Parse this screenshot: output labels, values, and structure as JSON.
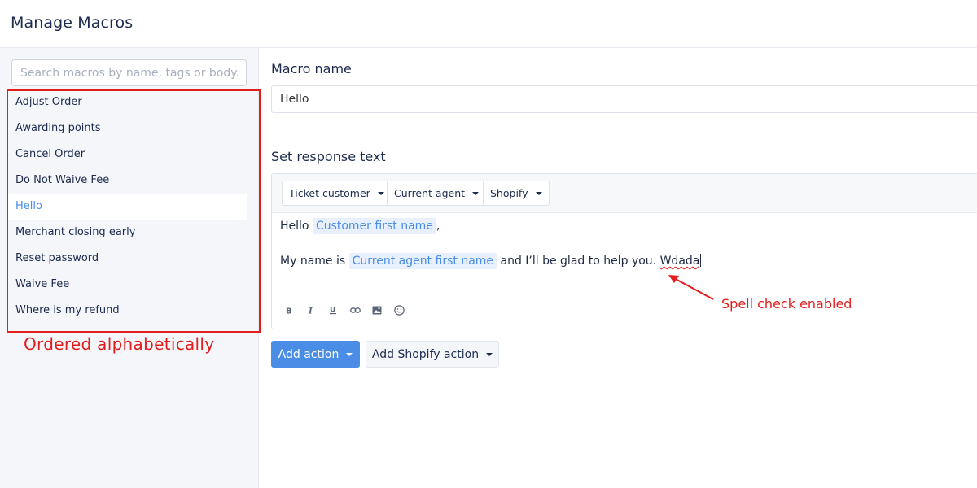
{
  "header": {
    "title": "Manage Macros"
  },
  "sidebar": {
    "search_placeholder": "Search macros by name, tags or body...",
    "macros": [
      {
        "label": "Adjust Order",
        "active": false
      },
      {
        "label": "Awarding points",
        "active": false
      },
      {
        "label": "Cancel Order",
        "active": false
      },
      {
        "label": "Do Not Waive Fee",
        "active": false
      },
      {
        "label": "Hello",
        "active": true
      },
      {
        "label": "Merchant closing early",
        "active": false
      },
      {
        "label": "Reset password",
        "active": false
      },
      {
        "label": "Waive Fee",
        "active": false
      },
      {
        "label": "Where is my refund",
        "active": false
      }
    ]
  },
  "annotations": {
    "ordered": "Ordered alphabetically",
    "spell": "Spell check enabled",
    "color": "#e41c1c"
  },
  "main": {
    "macro_name_label": "Macro name",
    "macro_name_value": "Hello",
    "response_label": "Set response text",
    "variable_buttons": [
      "Ticket customer",
      "Current agent",
      "Shopify"
    ],
    "body": {
      "line1_prefix": "Hello ",
      "line1_tag": "Customer first name",
      "line1_suffix": ",",
      "line2_prefix": "My name is ",
      "line2_tag": "Current agent first name",
      "line2_suffix": " and I’ll be glad to help you. ",
      "line2_misspelled": "Wdada"
    },
    "format_icons": [
      "bold-icon",
      "italic-icon",
      "underline-icon",
      "link-icon",
      "image-icon",
      "emoji-icon"
    ],
    "add_action_label": "Add action",
    "add_shopify_action_label": "Add Shopify action"
  },
  "colors": {
    "accent": "#4a8de6",
    "text": "#1c2b4e",
    "annotation": "#e41c1c"
  }
}
